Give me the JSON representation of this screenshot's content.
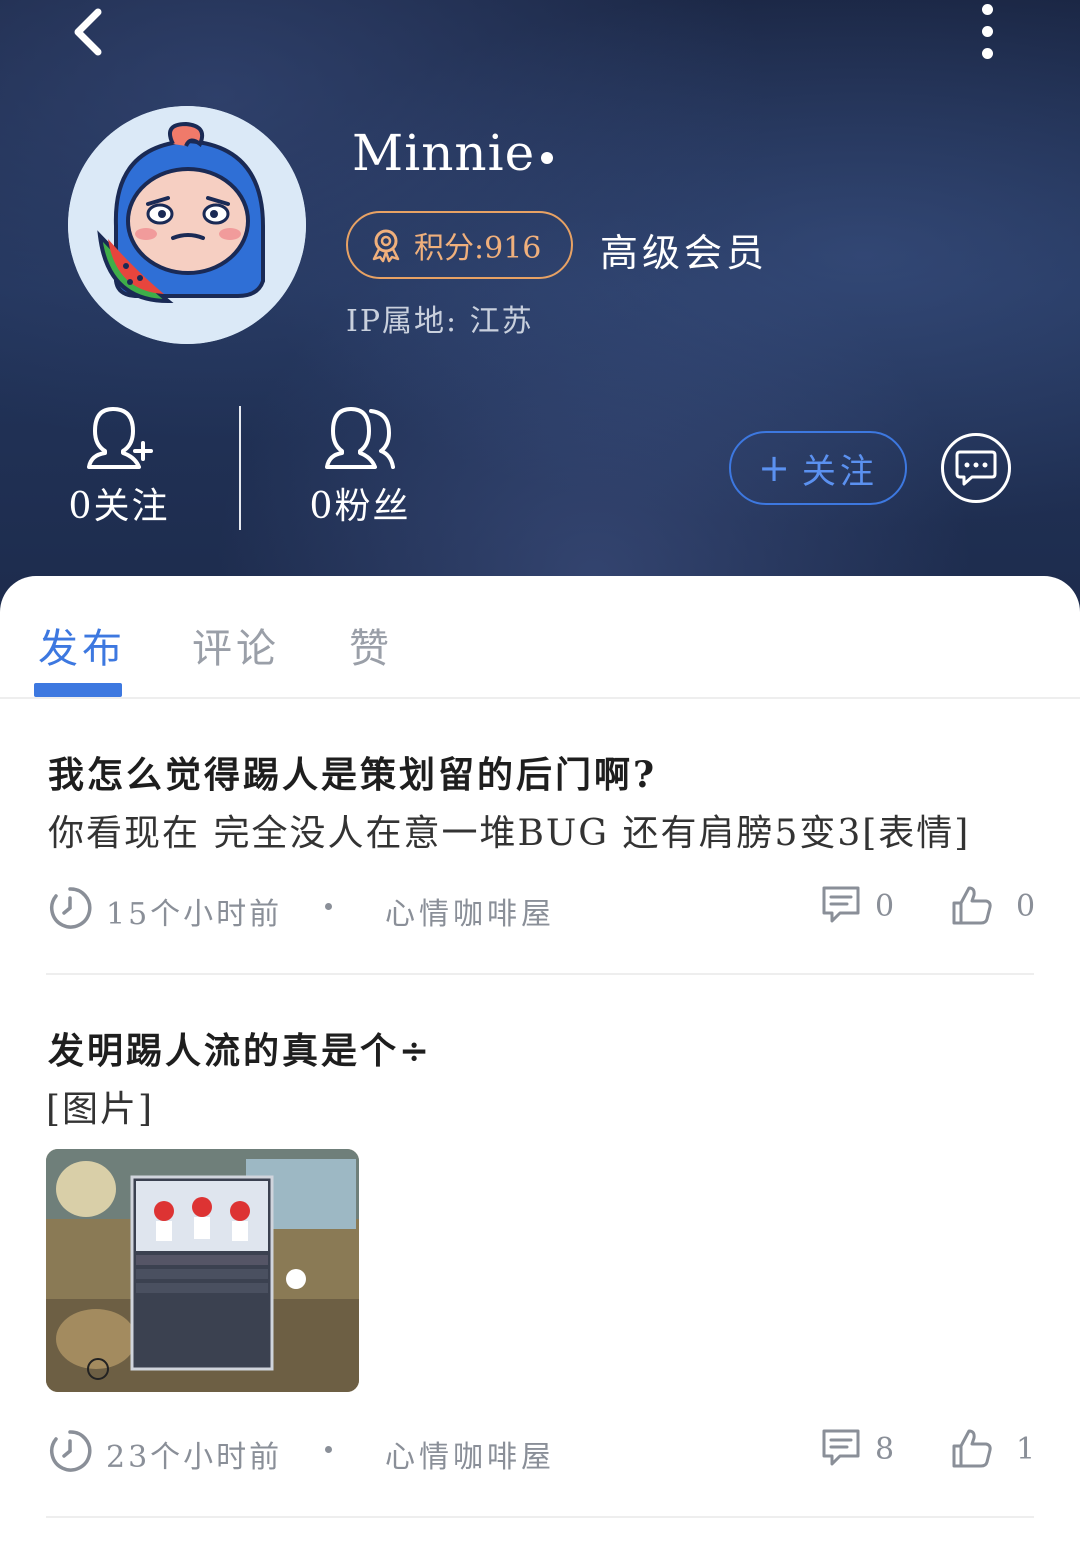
{
  "profile": {
    "username": "Minnie",
    "points_label": "积分:916",
    "member_level": "高级会员",
    "ip_location": "IP属地: 江苏",
    "following_label": "0关注",
    "followers_label": "0粉丝",
    "follow_button": "关注"
  },
  "tabs": [
    {
      "label": "发布",
      "active": true
    },
    {
      "label": "评论",
      "active": false
    },
    {
      "label": "赞",
      "active": false
    }
  ],
  "posts": [
    {
      "title": "我怎么觉得踢人是策划留的后门啊?",
      "body": "你看现在  完全没人在意一堆BUG  还有肩膀5变3[表情]",
      "time": "15个小时前",
      "board": "心情咖啡屋",
      "comments": "0",
      "likes": "0"
    },
    {
      "title": "发明踢人流的真是个÷",
      "body": "[图片]",
      "time": "23个小时前",
      "board": "心情咖啡屋",
      "comments": "8",
      "likes": "1"
    }
  ],
  "colors": {
    "accent": "#3d78e0",
    "points_badge": "#e8a264",
    "header_bg": "#1d2b4c"
  }
}
